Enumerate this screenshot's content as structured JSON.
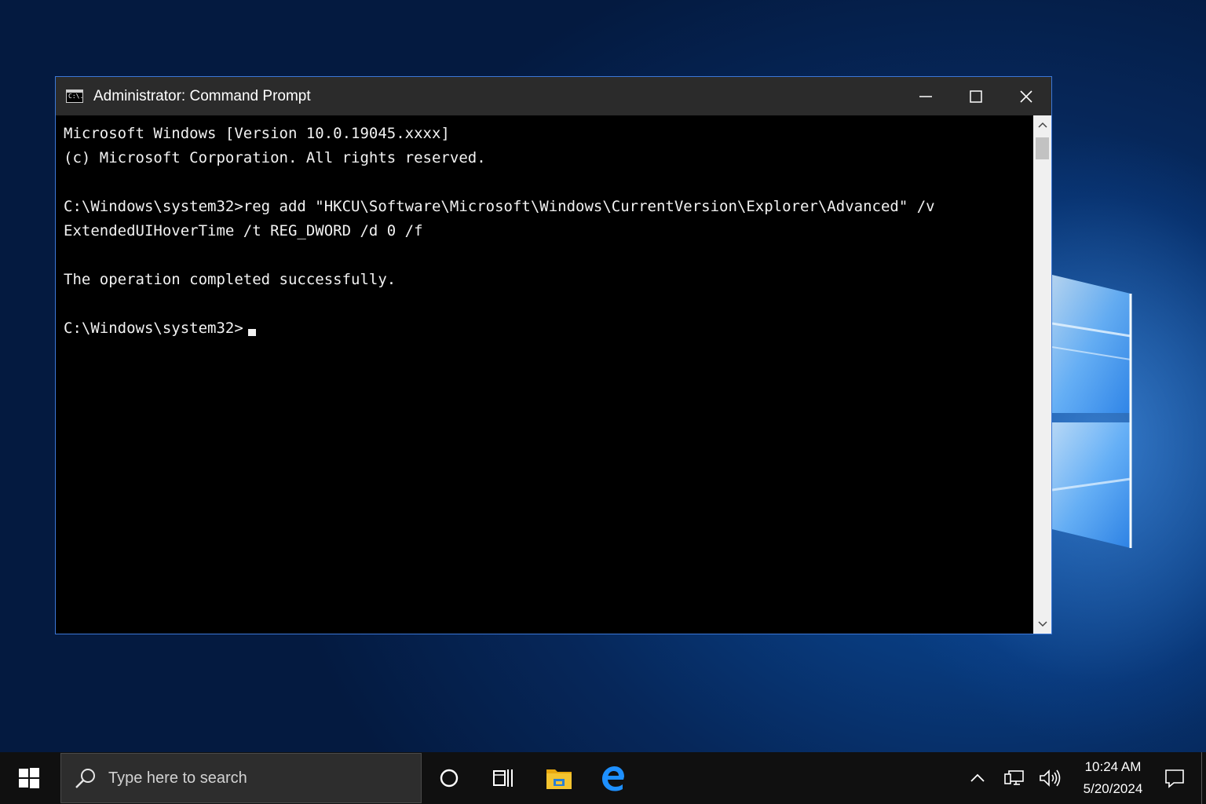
{
  "window": {
    "title": "Administrator: Command Prompt",
    "icon": "cmd-icon",
    "icon_text": "C:\\.",
    "controls": [
      "minimize-icon",
      "maximize-icon",
      "close-icon"
    ]
  },
  "console": {
    "lines": [
      "Microsoft Windows [Version 10.0.19045.xxxx]",
      "(c) Microsoft Corporation. All rights reserved.",
      "",
      "C:\\Windows\\system32>reg add \"HKCU\\Software\\Microsoft\\Windows\\CurrentVersion\\Explorer\\Advanced\" /v",
      "ExtendedUIHoverTime /t REG_DWORD /d 0 /f",
      "",
      "The operation completed successfully.",
      "",
      "C:\\Windows\\system32>"
    ]
  },
  "taskbar": {
    "search_placeholder": "Type here to search",
    "apps": [
      "cortana-icon",
      "task-view-icon",
      "file-explorer-icon",
      "edge-icon"
    ],
    "tray": [
      "chevron-up-icon",
      "network-icon",
      "volume-icon"
    ],
    "time": "10:24 AM",
    "date": "5/20/2024"
  },
  "colors": {
    "titlebar": "#2b2b2b",
    "console_bg": "#000000",
    "console_fg": "#f2f2f2",
    "window_border": "#3c78d8",
    "taskbar": "#101010",
    "edge_blue": "#1e90ff",
    "folder_yellow": "#f4c430"
  }
}
